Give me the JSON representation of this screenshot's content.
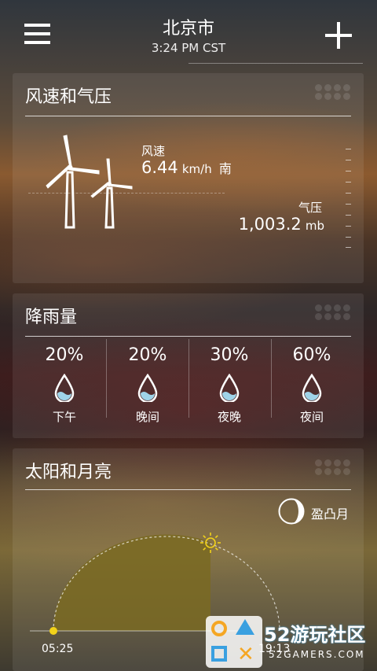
{
  "header": {
    "city": "北京市",
    "time": "3:24 PM CST"
  },
  "wind_pressure": {
    "title": "风速和气压",
    "wind_label": "风速",
    "wind_value": "6.44",
    "wind_unit": "km/h",
    "wind_direction": "南",
    "pressure_label": "气压",
    "pressure_value": "1,003.2",
    "pressure_unit": "mb"
  },
  "precipitation": {
    "title": "降雨量",
    "periods": [
      {
        "percent": "20%",
        "label": "下午"
      },
      {
        "percent": "20%",
        "label": "晚间"
      },
      {
        "percent": "30%",
        "label": "夜晚"
      },
      {
        "percent": "60%",
        "label": "夜间"
      }
    ]
  },
  "sun_moon": {
    "title": "太阳和月亮",
    "moon_phase": "盈凸月",
    "sunrise": "05:25",
    "sunset": "19:13"
  },
  "watermark": {
    "text": "52游玩社区",
    "subtext": "52GAMERS.COM"
  },
  "colors": {
    "sun_fill": "#7a6a22",
    "sun_yellow": "#f2d21a",
    "drop_water": "#9fd3e8",
    "wm_orange": "#f5a623",
    "wm_blue": "#3aa0e0"
  }
}
